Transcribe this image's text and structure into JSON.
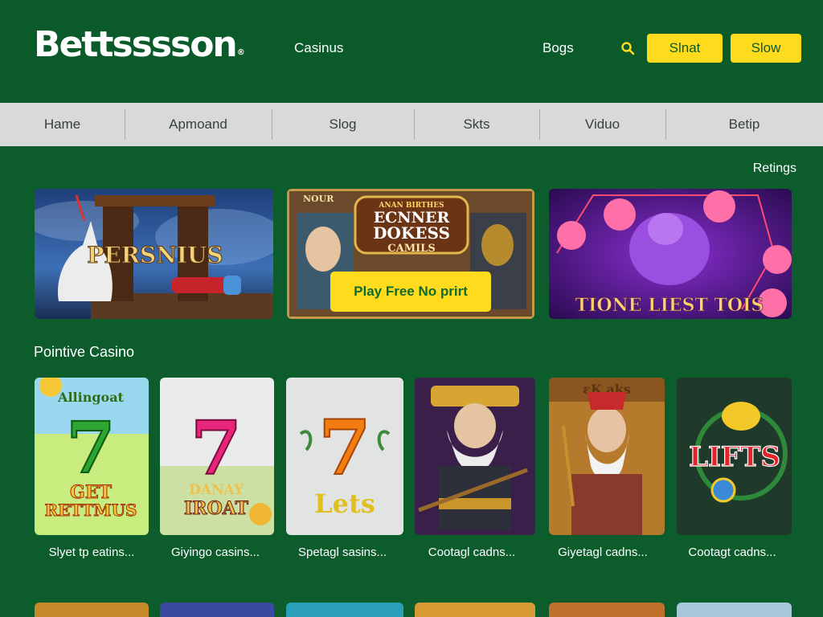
{
  "header": {
    "logo_text": "Bettsssson",
    "logo_mark": "®",
    "nav": {
      "casinos": "Casinus",
      "blogs": "Bogs"
    },
    "search_icon": "search-icon",
    "btn_primary": "Slnat",
    "btn_secondary": "Slow",
    "accent": "#ffdb1e",
    "brand": "#0b5a2a"
  },
  "subnav": {
    "items": [
      "Hame",
      "Apmoand",
      "Slog",
      "Skts",
      "Viduo",
      "Betip"
    ]
  },
  "ratings_link": "Retings",
  "featured": {
    "tile1_title": "PERSNIUS",
    "tile2_title_top": "ECNNER",
    "tile2_title_mid": "DOKESS",
    "tile2_title_bottom": "CAMILS",
    "tile2_banner": "ANAN BIRTHES",
    "tile2_corner": "NOUR",
    "tile2_button": "Play Free No prirt",
    "tile3_title": "TIONE LIEST TOIS"
  },
  "section": {
    "title": "Pointive Casino"
  },
  "games": [
    {
      "caption": "Slyet tp eatins...",
      "art_top": "Allingoat",
      "art_bottom_1": "GET",
      "art_bottom_2": "RETTMUS"
    },
    {
      "caption": "Giyingo casins...",
      "art_bottom_1": "DANAY",
      "art_bottom_2": "IROAT"
    },
    {
      "caption": "Spetagl sasins...",
      "art_bottom_1": "Lets"
    },
    {
      "caption": "Cootagl cadns..."
    },
    {
      "caption": "Giyetagl cadns...",
      "art_top": "ɛK aks"
    },
    {
      "caption": "Cootagt cadns...",
      "art_bottom_1": "LIFTS"
    }
  ]
}
